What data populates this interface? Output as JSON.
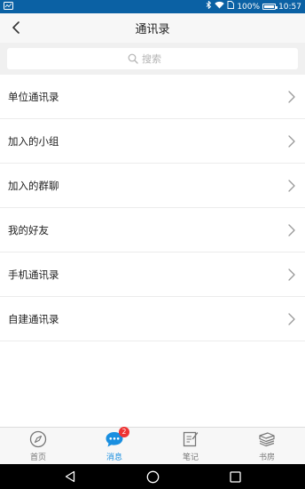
{
  "status_bar": {
    "battery_percent": "100%",
    "time": "10:57",
    "battery_level": 1.0
  },
  "header": {
    "title": "通讯录",
    "back_icon": "chevron-left-icon"
  },
  "search": {
    "placeholder": "搜索",
    "icon": "search-icon"
  },
  "contacts": {
    "items": [
      {
        "label": "单位通讯录"
      },
      {
        "label": "加入的小组"
      },
      {
        "label": "加入的群聊"
      },
      {
        "label": "我的好友"
      },
      {
        "label": "手机通讯录"
      },
      {
        "label": "自建通讯录"
      }
    ]
  },
  "tab_bar": {
    "active_color": "#1a8fe0",
    "tabs": [
      {
        "label": "首页",
        "icon": "compass-icon"
      },
      {
        "label": "消息",
        "icon": "chat-bubble-icon",
        "badge": "2",
        "active": true
      },
      {
        "label": "笔记",
        "icon": "note-edit-icon"
      },
      {
        "label": "书房",
        "icon": "books-icon"
      }
    ]
  },
  "colors": {
    "status_bar": "#0b61a4",
    "badge": "#ee3333",
    "accent": "#1a8fe0"
  }
}
